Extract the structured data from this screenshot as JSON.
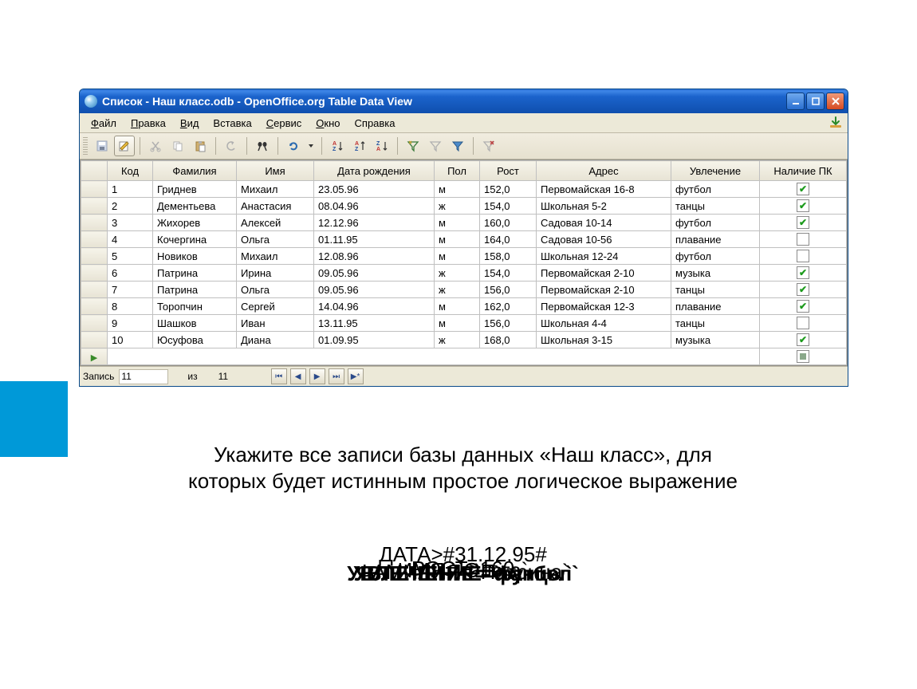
{
  "titlebar": {
    "title": "Список  - Наш класс.odb - OpenOffice.org Table Data View"
  },
  "menu": {
    "items": [
      {
        "label": "Файл",
        "u": 0
      },
      {
        "label": "Правка",
        "u": 0
      },
      {
        "label": "Вид",
        "u": 0
      },
      {
        "label": "Вставка",
        "u": -1
      },
      {
        "label": "Сервис",
        "u": 0
      },
      {
        "label": "Окно",
        "u": 0
      },
      {
        "label": "Справка",
        "u": -1
      }
    ]
  },
  "columns": [
    "",
    "Код",
    "Фамилия",
    "Имя",
    "Дата рождения",
    "Пол",
    "Рост",
    "Адрес",
    "Увлечение",
    "Наличие ПК"
  ],
  "rows": [
    {
      "code": "1",
      "fam": "Гриднев",
      "name": "Михаил",
      "date": "23.05.96",
      "sex": "м",
      "height": "152,0",
      "addr": "Первомайская 16-8",
      "hobby": "футбол",
      "pc": true
    },
    {
      "code": "2",
      "fam": "Дементьева",
      "name": "Анастасия",
      "date": "08.04.96",
      "sex": "ж",
      "height": "154,0",
      "addr": "Школьная 5-2",
      "hobby": "танцы",
      "pc": true
    },
    {
      "code": "3",
      "fam": "Жихорев",
      "name": "Алексей",
      "date": "12.12.96",
      "sex": "м",
      "height": "160,0",
      "addr": "Садовая 10-14",
      "hobby": "футбол",
      "pc": true
    },
    {
      "code": "4",
      "fam": "Кочергина",
      "name": "Ольга",
      "date": "01.11.95",
      "sex": "м",
      "height": "164,0",
      "addr": "Садовая 10-56",
      "hobby": "плавание",
      "pc": false
    },
    {
      "code": "5",
      "fam": "Новиков",
      "name": "Михаил",
      "date": "12.08.96",
      "sex": "м",
      "height": "158,0",
      "addr": "Школьная 12-24",
      "hobby": "футбол",
      "pc": false
    },
    {
      "code": "6",
      "fam": "Патрина",
      "name": "Ирина",
      "date": "09.05.96",
      "sex": "ж",
      "height": "154,0",
      "addr": "Первомайская 2-10",
      "hobby": "музыка",
      "pc": true
    },
    {
      "code": "7",
      "fam": "Патрина",
      "name": "Ольга",
      "date": "09.05.96",
      "sex": "ж",
      "height": "156,0",
      "addr": "Первомайская 2-10",
      "hobby": "танцы",
      "pc": true
    },
    {
      "code": "8",
      "fam": "Торопчин",
      "name": "Сергей",
      "date": "14.04.96",
      "sex": "м",
      "height": "162,0",
      "addr": "Первомайская 12-3",
      "hobby": "плавание",
      "pc": true
    },
    {
      "code": "9",
      "fam": "Шашков",
      "name": "Иван",
      "date": "13.11.95",
      "sex": "м",
      "height": "156,0",
      "addr": "Школьная 4-4",
      "hobby": "танцы",
      "pc": false
    },
    {
      "code": "10",
      "fam": "Юсуфова",
      "name": "Диана",
      "date": "01.09.95",
      "sex": "ж",
      "height": "168,0",
      "addr": "Школьная 3-15",
      "hobby": "музыка",
      "pc": true
    }
  ],
  "recordbar": {
    "label": "Запись",
    "current": "11",
    "of_label": "из",
    "total": "11"
  },
  "question": {
    "line1": "Укажите все записи базы данных «Наш класс», для",
    "line2": "которых будет истинным простое логическое выражение"
  },
  "overlay": {
    "l1": "ДАТА>#31.12.95#",
    "l2": "УВЛЕЧЕНИЕ=`футбол`",
    "l3": "РОСТ>160",
    "l4": "ИМЯ=`Ольга`",
    "l5": "ФАМИЛИЯ=`Патрина`",
    "l6": "УВЛЕЧЕНИЕ=`танцы`"
  }
}
